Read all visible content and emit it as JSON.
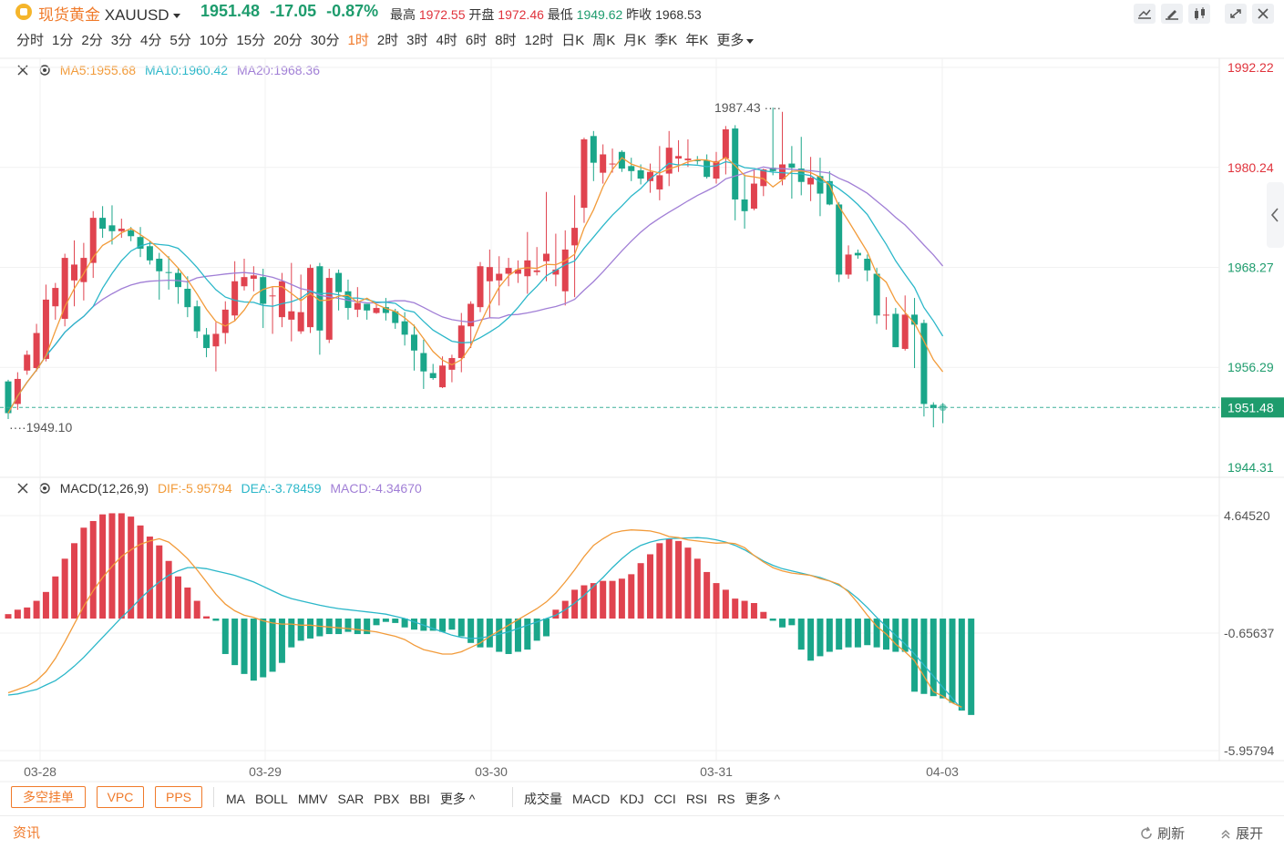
{
  "header": {
    "name": "现货黄金",
    "symbol": "XAUUSD",
    "last": "1951.48",
    "change": "-17.05",
    "change_pct": "-0.87%",
    "high_label": "最高",
    "high": "1972.55",
    "open_label": "开盘",
    "open": "1972.46",
    "low_label": "最低",
    "low": "1949.62",
    "prev_label": "昨收",
    "prev": "1968.53"
  },
  "timeframes": [
    "分时",
    "1分",
    "2分",
    "3分",
    "4分",
    "5分",
    "10分",
    "15分",
    "20分",
    "30分",
    "1时",
    "2时",
    "3时",
    "4时",
    "6时",
    "8时",
    "12时",
    "日K",
    "周K",
    "月K",
    "季K",
    "年K",
    "更多"
  ],
  "active_timeframe": "1时",
  "price_legend": {
    "ma5": "MA5:1955.68",
    "ma10": "MA10:1960.42",
    "ma20": "MA20:1968.36"
  },
  "macd_legend": {
    "name": "MACD(12,26,9)",
    "dif": "DIF:-5.95794",
    "dea": "DEA:-3.78459",
    "macd": "MACD:-4.34670"
  },
  "colors": {
    "up": "#e0434f",
    "down": "#1aa68a",
    "ma5": "#f29b3a",
    "ma10": "#2bb7c9",
    "ma20": "#a17fd6",
    "accent": "#f07a2a"
  },
  "chart_data": [
    {
      "type": "candlestick",
      "x_ticks": [
        "03-28",
        "03-29",
        "03-30",
        "03-31",
        "04-03"
      ],
      "y_ticks": [
        "1992.22",
        "1980.24",
        "1968.27",
        "1956.29",
        "1944.31"
      ],
      "ylim": [
        1944.31,
        1992.22
      ],
      "last_price_tag": "1951.48",
      "annotations": [
        {
          "text": "1987.43",
          "value": 1987.43
        },
        {
          "text": "1949.10",
          "value": 1949.1
        }
      ],
      "ohlc": [
        [
          1954.6,
          1954.8,
          1950.1,
          1950.8
        ],
        [
          1951.9,
          1955.7,
          1951.2,
          1954.9
        ],
        [
          1955.9,
          1958.3,
          1955.4,
          1957.8
        ],
        [
          1956.2,
          1961.5,
          1955.8,
          1960.4
        ],
        [
          1957.3,
          1966.2,
          1957.0,
          1964.4
        ],
        [
          1963.6,
          1966.4,
          1962.0,
          1965.8
        ],
        [
          1962.1,
          1969.9,
          1961.2,
          1969.4
        ],
        [
          1966.7,
          1971.5,
          1963.6,
          1968.6
        ],
        [
          1966.5,
          1971.2,
          1964.3,
          1969.4
        ],
        [
          1968.8,
          1975.0,
          1967.0,
          1974.2
        ],
        [
          1974.2,
          1975.6,
          1971.8,
          1972.9
        ],
        [
          1973.3,
          1975.7,
          1971.0,
          1972.6
        ],
        [
          1972.6,
          1974.1,
          1971.8,
          1972.9
        ],
        [
          1972.7,
          1973.1,
          1971.4,
          1972.0
        ],
        [
          1971.9,
          1973.1,
          1969.5,
          1970.5
        ],
        [
          1970.8,
          1971.4,
          1968.6,
          1969.1
        ],
        [
          1969.3,
          1970.0,
          1964.4,
          1967.8
        ],
        [
          1967.7,
          1969.6,
          1965.6,
          1967.6
        ],
        [
          1967.6,
          1968.2,
          1963.9,
          1965.9
        ],
        [
          1965.7,
          1967.2,
          1962.3,
          1963.5
        ],
        [
          1963.6,
          1964.3,
          1959.8,
          1960.6
        ],
        [
          1960.2,
          1961.0,
          1957.5,
          1958.6
        ],
        [
          1958.8,
          1961.7,
          1955.8,
          1960.3
        ],
        [
          1960.4,
          1964.2,
          1959.1,
          1963.2
        ],
        [
          1962.5,
          1969.0,
          1961.8,
          1966.6
        ],
        [
          1966.0,
          1969.3,
          1965.5,
          1967.1
        ],
        [
          1966.9,
          1968.4,
          1965.4,
          1967.3
        ],
        [
          1967.1,
          1968.1,
          1961.0,
          1963.9
        ],
        [
          1964.8,
          1965.9,
          1960.3,
          1964.9
        ],
        [
          1962.3,
          1967.6,
          1961.1,
          1966.6
        ],
        [
          1962.0,
          1968.8,
          1959.4,
          1963.0
        ],
        [
          1960.6,
          1967.4,
          1960.3,
          1962.9
        ],
        [
          1961.1,
          1968.6,
          1960.4,
          1968.2
        ],
        [
          1968.4,
          1968.8,
          1957.8,
          1960.7
        ],
        [
          1959.6,
          1968.1,
          1959.2,
          1967.0
        ],
        [
          1967.6,
          1968.0,
          1963.1,
          1965.3
        ],
        [
          1965.4,
          1966.8,
          1962.0,
          1963.4
        ],
        [
          1963.2,
          1965.9,
          1962.3,
          1964.0
        ],
        [
          1963.9,
          1963.9,
          1962.0,
          1963.1
        ],
        [
          1962.8,
          1963.9,
          1962.7,
          1963.4
        ],
        [
          1963.5,
          1964.6,
          1961.9,
          1962.8
        ],
        [
          1963.0,
          1963.3,
          1960.9,
          1961.6
        ],
        [
          1961.8,
          1962.9,
          1958.9,
          1960.2
        ],
        [
          1960.2,
          1961.4,
          1955.9,
          1958.3
        ],
        [
          1958.0,
          1959.6,
          1953.7,
          1955.8
        ],
        [
          1955.6,
          1956.7,
          1954.8,
          1955.0
        ],
        [
          1953.9,
          1957.6,
          1953.8,
          1956.5
        ],
        [
          1956.0,
          1957.8,
          1954.5,
          1957.4
        ],
        [
          1957.4,
          1962.8,
          1955.7,
          1961.3
        ],
        [
          1961.2,
          1964.2,
          1958.6,
          1963.9
        ],
        [
          1963.5,
          1968.9,
          1962.9,
          1968.4
        ],
        [
          1966.6,
          1970.4,
          1962.2,
          1968.3
        ],
        [
          1966.7,
          1969.6,
          1963.7,
          1967.5
        ],
        [
          1967.5,
          1969.4,
          1966.0,
          1968.2
        ],
        [
          1967.5,
          1969.1,
          1966.4,
          1968.0
        ],
        [
          1967.2,
          1972.5,
          1965.1,
          1969.1
        ],
        [
          1967.7,
          1970.7,
          1967.3,
          1967.9
        ],
        [
          1969.0,
          1977.3,
          1966.6,
          1969.9
        ],
        [
          1967.4,
          1972.3,
          1966.0,
          1968.0
        ],
        [
          1965.4,
          1972.7,
          1963.7,
          1970.4
        ],
        [
          1970.9,
          1976.9,
          1964.7,
          1973.0
        ],
        [
          1975.4,
          1983.8,
          1973.6,
          1983.6
        ],
        [
          1984.0,
          1984.6,
          1978.6,
          1980.8
        ],
        [
          1979.6,
          1983.0,
          1978.3,
          1981.8
        ],
        [
          1980.6,
          1982.5,
          1979.6,
          1980.7
        ],
        [
          1982.1,
          1982.3,
          1979.7,
          1980.1
        ],
        [
          1980.4,
          1981.4,
          1978.6,
          1979.8
        ],
        [
          1979.9,
          1980.6,
          1978.2,
          1978.9
        ],
        [
          1978.6,
          1980.7,
          1977.2,
          1979.7
        ],
        [
          1977.6,
          1982.8,
          1976.3,
          1979.3
        ],
        [
          1979.5,
          1984.6,
          1978.0,
          1982.6
        ],
        [
          1981.3,
          1983.5,
          1979.7,
          1981.6
        ],
        [
          1981.1,
          1983.6,
          1980.3,
          1981.3
        ],
        [
          1981.1,
          1981.6,
          1980.6,
          1981.0
        ],
        [
          1981.1,
          1981.8,
          1978.9,
          1979.1
        ],
        [
          1978.9,
          1982.1,
          1978.3,
          1981.0
        ],
        [
          1981.3,
          1985.2,
          1979.4,
          1984.8
        ],
        [
          1984.9,
          1985.3,
          1973.9,
          1976.4
        ],
        [
          1976.4,
          1979.4,
          1972.9,
          1975.0
        ],
        [
          1975.3,
          1979.9,
          1975.1,
          1978.3
        ],
        [
          1978.0,
          1980.1,
          1976.8,
          1980.0
        ],
        [
          1980.2,
          1987.4,
          1979.3,
          1979.8
        ],
        [
          1978.8,
          1986.9,
          1978.1,
          1980.6
        ],
        [
          1980.7,
          1982.8,
          1976.5,
          1980.2
        ],
        [
          1980.1,
          1983.9,
          1976.9,
          1978.5
        ],
        [
          1978.2,
          1981.5,
          1976.2,
          1979.0
        ],
        [
          1979.2,
          1981.4,
          1974.4,
          1977.1
        ],
        [
          1978.6,
          1979.8,
          1975.7,
          1975.8
        ],
        [
          1975.8,
          1976.1,
          1966.5,
          1967.4
        ],
        [
          1967.4,
          1970.9,
          1966.9,
          1969.8
        ],
        [
          1970.0,
          1970.4,
          1969.3,
          1969.7
        ],
        [
          1969.3,
          1969.8,
          1966.6,
          1967.9
        ],
        [
          1967.5,
          1968.2,
          1961.5,
          1962.5
        ],
        [
          1962.5,
          1964.7,
          1960.8,
          1962.6
        ],
        [
          1962.7,
          1963.4,
          1958.7,
          1958.7
        ],
        [
          1958.5,
          1964.9,
          1958.3,
          1962.6
        ],
        [
          1962.6,
          1964.6,
          1956.2,
          1961.4
        ],
        [
          1961.6,
          1962.0,
          1950.4,
          1951.9
        ],
        [
          1951.8,
          1952.1,
          1949.1,
          1951.4
        ],
        [
          1951.6,
          1952.0,
          1949.6,
          1951.5
        ]
      ]
    },
    {
      "type": "bar",
      "name": "MACD(12,26,9)",
      "y_ticks": [
        "4.64520",
        "-0.65637",
        "-5.95794"
      ],
      "ylim": [
        -5.95794,
        4.6452
      ],
      "series": [
        {
          "name": "DIF",
          "values": [
            -3.35,
            -3.2,
            -3.05,
            -2.8,
            -2.4,
            -1.8,
            -1.05,
            -0.25,
            0.55,
            1.25,
            1.85,
            2.35,
            2.8,
            3.1,
            3.35,
            3.5,
            3.6,
            3.45,
            3.1,
            2.7,
            2.2,
            1.65,
            1.1,
            0.65,
            0.35,
            0.15,
            0.05,
            -0.1,
            -0.2,
            -0.25,
            -0.25,
            -0.3,
            -0.3,
            -0.35,
            -0.38,
            -0.42,
            -0.45,
            -0.5,
            -0.55,
            -0.6,
            -0.7,
            -0.8,
            -0.95,
            -1.2,
            -1.4,
            -1.5,
            -1.6,
            -1.6,
            -1.5,
            -1.3,
            -1.1,
            -0.8,
            -0.55,
            -0.3,
            -0.05,
            0.2,
            0.45,
            0.75,
            1.15,
            1.65,
            2.2,
            2.8,
            3.3,
            3.6,
            3.85,
            3.95,
            4.0,
            3.98,
            3.95,
            3.85,
            3.7,
            3.65,
            3.55,
            3.5,
            3.45,
            3.4,
            3.42,
            3.38,
            3.2,
            2.85,
            2.55,
            2.3,
            2.15,
            2.05,
            2.0,
            1.95,
            1.8,
            1.7,
            1.55,
            1.2,
            0.7,
            0.15,
            -0.35,
            -0.7,
            -1.15,
            -1.5,
            -1.9,
            -2.6,
            -3.3,
            -3.5,
            -3.8,
            -4.0
          ]
        },
        {
          "name": "DEA",
          "values": [
            -3.45,
            -3.4,
            -3.3,
            -3.2,
            -3.0,
            -2.8,
            -2.5,
            -2.15,
            -1.75,
            -1.3,
            -0.85,
            -0.4,
            0.05,
            0.45,
            0.9,
            1.3,
            1.65,
            1.95,
            2.15,
            2.3,
            2.3,
            2.25,
            2.15,
            2.05,
            1.95,
            1.8,
            1.65,
            1.45,
            1.25,
            1.05,
            0.9,
            0.8,
            0.7,
            0.6,
            0.52,
            0.45,
            0.4,
            0.35,
            0.3,
            0.25,
            0.2,
            0.1,
            0.0,
            -0.15,
            -0.3,
            -0.45,
            -0.6,
            -0.75,
            -0.85,
            -0.9,
            -0.88,
            -0.8,
            -0.7,
            -0.6,
            -0.45,
            -0.3,
            -0.15,
            0.0,
            0.15,
            0.4,
            0.7,
            1.05,
            1.45,
            1.85,
            2.3,
            2.7,
            3.05,
            3.3,
            3.45,
            3.55,
            3.6,
            3.62,
            3.64,
            3.65,
            3.62,
            3.55,
            3.45,
            3.3,
            3.1,
            2.85,
            2.6,
            2.4,
            2.25,
            2.15,
            2.05,
            1.95,
            1.85,
            1.7,
            1.5,
            1.25,
            0.9,
            0.5,
            0.05,
            -0.35,
            -0.75,
            -1.15,
            -1.6,
            -2.1,
            -2.6,
            -3.1,
            -3.6,
            -4.1
          ]
        },
        {
          "name": "MACD",
          "values": [
            0.2,
            0.4,
            0.5,
            0.8,
            1.2,
            1.9,
            2.7,
            3.4,
            4.1,
            4.4,
            4.7,
            4.75,
            4.75,
            4.6,
            4.2,
            3.7,
            3.3,
            2.6,
            1.9,
            1.4,
            0.8,
            0.1,
            -0.1,
            -1.6,
            -2.1,
            -2.5,
            -2.8,
            -2.65,
            -2.4,
            -2.0,
            -1.3,
            -1.0,
            -0.9,
            -0.8,
            -0.7,
            -0.7,
            -0.6,
            -0.7,
            -0.7,
            -0.3,
            -0.15,
            -0.2,
            -0.4,
            -0.5,
            -0.55,
            -0.55,
            -0.6,
            -0.5,
            -0.8,
            -1.1,
            -1.3,
            -1.3,
            -1.5,
            -1.6,
            -1.5,
            -1.4,
            -1.0,
            -0.8,
            0.4,
            0.8,
            1.3,
            1.5,
            1.6,
            1.7,
            1.7,
            1.8,
            2.0,
            2.5,
            2.9,
            3.4,
            3.6,
            3.5,
            3.2,
            2.7,
            2.1,
            1.6,
            1.3,
            0.9,
            0.8,
            0.7,
            0.3,
            -0.1,
            -0.4,
            -0.3,
            -1.4,
            -1.9,
            -1.7,
            -1.5,
            -1.4,
            -1.3,
            -1.3,
            -1.2,
            -1.3,
            -1.4,
            -1.5,
            -1.5,
            -3.3,
            -3.4,
            -3.5,
            -3.6,
            -3.8,
            -4.15,
            -4.35
          ]
        }
      ]
    }
  ],
  "bottom_toolbar": {
    "buttons": [
      "多空挂单",
      "VPC",
      "PPS"
    ],
    "main_indicators": [
      "MA",
      "BOLL",
      "MMV",
      "SAR",
      "PBX",
      "BBI",
      "更多 ^"
    ],
    "sub_indicators": [
      "成交量",
      "MACD",
      "KDJ",
      "CCI",
      "RSI",
      "RS",
      "更多 ^"
    ]
  },
  "footer": {
    "news": "资讯",
    "refresh": "刷新",
    "expand": "展开"
  }
}
